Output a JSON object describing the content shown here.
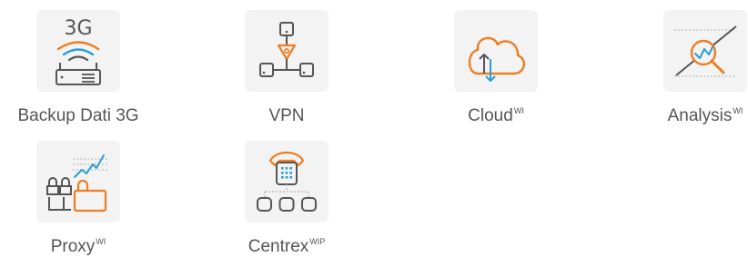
{
  "services": [
    {
      "title": "Backup Dati 3G",
      "badge": "",
      "icon": "3g-router-icon"
    },
    {
      "title": "VPN",
      "badge": "",
      "icon": "vpn-network-icon"
    },
    {
      "title": "Cloud",
      "badge": "WI",
      "icon": "cloud-sync-icon"
    },
    {
      "title": "Analysis",
      "badge": "WI",
      "icon": "analysis-magnifier-icon"
    },
    {
      "title": "Proxy",
      "badge": "WI",
      "icon": "proxy-lock-icon"
    },
    {
      "title": "Centrex",
      "badge": "WIP",
      "icon": "centrex-phone-icon"
    }
  ],
  "icon_text": {
    "router_label": "3G"
  },
  "colors": {
    "tile_bg": "#f3f3f3",
    "outline": "#555555",
    "accent_orange": "#ef7d22",
    "accent_blue": "#2b9ed8",
    "dotted_gray": "#bbbbbb"
  }
}
